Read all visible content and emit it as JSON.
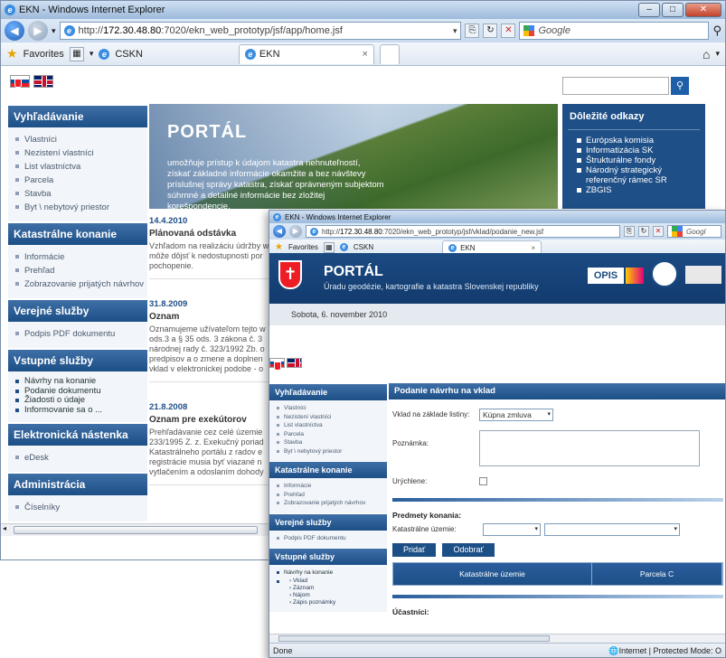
{
  "win1": {
    "title": "EKN - Windows Internet Explorer",
    "url_prefix": "http://",
    "url_host": "172.30.48.80",
    "url_rest": ":7020/ekn_web_prototyp/jsf/app/home.jsf",
    "search_placeholder": "Google",
    "favorites": "Favorites",
    "fav_tab": "CSKN",
    "tab_label": "EKN",
    "tab_close": "×"
  },
  "portal": {
    "hero_title": "PORTÁL",
    "hero_text": "umožňuje prístup k údajom katastra nehnuteľností, získať základné informácie okamžite a bez návštevy príslušnej správy katastra, získať oprávneným subjektom súhrnné a detailné informácie bez zložitej korešpondencie.",
    "links_title": "Dôležité odkazy",
    "links": [
      "Európska komisia",
      "Informatizácia SK",
      "Štrukturálne fondy",
      "Národný strategický referenčný rámec SR",
      "ZBGIS"
    ],
    "sidebar": [
      {
        "title": "Vyhľadávanie",
        "items": [
          "Vlastníci",
          "Nezistení vlastníci",
          "List vlastníctva",
          "Parcela",
          "Stavba",
          "Byt \\ nebytový priestor"
        ]
      },
      {
        "title": "Katastrálne konanie",
        "items": [
          "Informácie",
          "Prehľad",
          "Zobrazovanie prijatých návrhov"
        ]
      },
      {
        "title": "Verejné služby",
        "items": [
          "Podpis PDF dokumentu"
        ]
      },
      {
        "title": "Vstupné služby",
        "items": [
          "Návrhy na konanie",
          "Podanie dokumentu",
          "Žiadosti o údaje",
          "Informovanie sa o ..."
        ]
      },
      {
        "title": "Elektronická nástenka",
        "items": [
          "eDesk"
        ]
      },
      {
        "title": "Administrácia",
        "items": [
          "Číselníky"
        ]
      }
    ],
    "news": [
      {
        "date": "14.4.2010",
        "title": "Plánovaná odstávka",
        "lines": [
          "Vzhľadom na realizáciu údržby w",
          "môže dôjsť k nedostupnosti por",
          "pochopenie."
        ]
      },
      {
        "date": "31.8.2009",
        "title": "Oznam",
        "lines": [
          "Oznamujeme užívateľom tejto w",
          "ods.3 a § 35 ods. 3 zákona č. 3",
          "národnej rady č. 323/1992 Zb. o",
          "predpisov a o zmene a doplnen",
          "vklad v elektronickej podobe - o"
        ]
      },
      {
        "date": "21.8.2008",
        "title": "Oznam pre exekútorov",
        "lines": [
          "Prehľadávanie cez celé územie",
          "233/1995 Z. z. Exekučný poriad",
          "Katastrálneho portálu z radov e",
          "registrácie musia byť viazané n",
          "vytlačením a odoslaním dohody"
        ]
      }
    ]
  },
  "win2": {
    "title": "EKN - Windows Internet Explorer",
    "url_prefix": "http://",
    "url_host": "172.30.48.80",
    "url_rest": ":7020/ekn_web_prototyp/jsf/vklad/podanie_new.jsf",
    "search_placeholder": "Googl",
    "favorites": "Favorites",
    "fav_tab": "CSKN",
    "tab_label": "EKN",
    "tab_close": "×",
    "portal_title": "PORTÁL",
    "portal_subtitle": "Úradu geodézie, kartografie a katastra Slovenskej republiky",
    "opis": "OPIS",
    "date": "Sobota, 6. november 2010",
    "sidebar": [
      {
        "title": "Vyhľadávanie",
        "items": [
          "Vlastníci",
          "Nezistení vlastníci",
          "List vlastníctva",
          "Parcela",
          "Stavba",
          "Byt \\ nebytový priestor"
        ]
      },
      {
        "title": "Katastrálne konanie",
        "items": [
          "Informácie",
          "Prehľad",
          "Zobrazovanie prijatých návrhov"
        ]
      },
      {
        "title": "Verejné služby",
        "items": [
          "Podpis PDF dokumentu"
        ]
      },
      {
        "title": "Vstupné služby",
        "items": [
          "Návrhy na konanie"
        ]
      }
    ],
    "vstupne_sub": [
      "› Vklad",
      "› Záznam",
      "› Nájom",
      "› Zápis poznámky"
    ],
    "form_title": "Podanie návrhu na vklad",
    "lbl_vklad": "Vklad na základe listiny:",
    "vklad_value": "Kúpna zmluva",
    "lbl_poznamka": "Poznámka:",
    "lbl_urychlene": "Urýchlene:",
    "predmety": "Predmety konania:",
    "lbl_ku": "Katastrálne územie:",
    "btn_pridat": "Pridať",
    "btn_odobrat": "Odobrať",
    "col_ku": "Katastrálne územie",
    "col_parcela": "Parcela C",
    "ucastnici": "Účastníci:",
    "status": "Done",
    "zone": "Internet | Protected Mode: O"
  }
}
